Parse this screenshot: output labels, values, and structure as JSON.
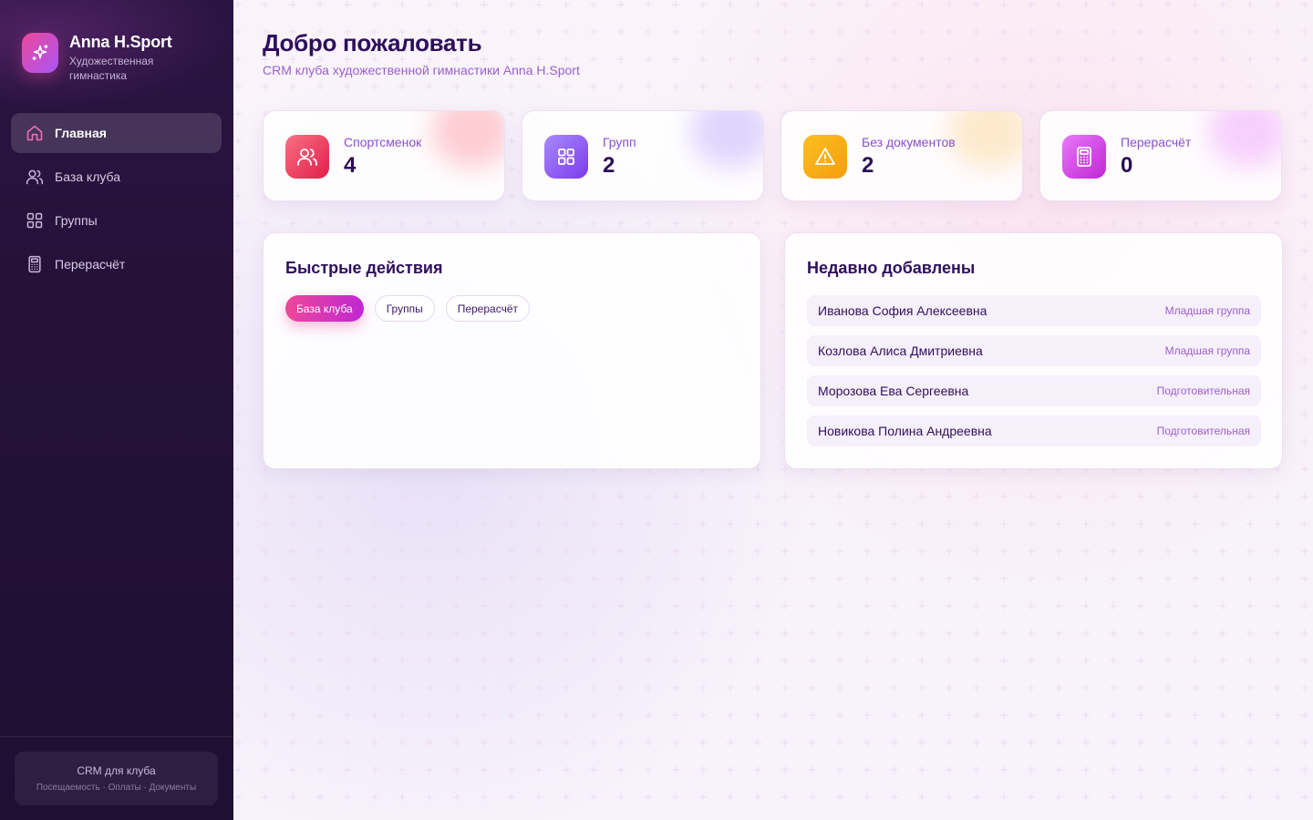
{
  "brand": {
    "title": "Anna H.Sport",
    "subtitle": "Художественная гимнастика",
    "icon": "sparkles-icon"
  },
  "nav": {
    "items": [
      {
        "label": "Главная",
        "icon": "home-icon",
        "active": true
      },
      {
        "label": "База клуба",
        "icon": "users-icon",
        "active": false
      },
      {
        "label": "Группы",
        "icon": "grid-icon",
        "active": false
      },
      {
        "label": "Перерасчёт",
        "icon": "calculator-icon",
        "active": false
      }
    ]
  },
  "sidebar_footer": {
    "title": "CRM для клуба",
    "subtitle": "Посещаемость · Оплаты · Документы"
  },
  "header": {
    "title": "Добро пожаловать",
    "subtitle": "CRM клуба художественной гимнастики Anna H.Sport"
  },
  "stats": [
    {
      "label": "Спортсменок",
      "value": "4",
      "icon": "users-icon",
      "color": "#f43f5e"
    },
    {
      "label": "Групп",
      "value": "2",
      "icon": "grid-icon",
      "color": "#8b5cf6"
    },
    {
      "label": "Без документов",
      "value": "2",
      "icon": "warning-icon",
      "color": "#f59e0b"
    },
    {
      "label": "Перерасчёт",
      "value": "0",
      "icon": "calculator-icon",
      "color": "#d946ef"
    }
  ],
  "quick_actions": {
    "title": "Быстрые действия",
    "buttons": [
      "База клуба",
      "Группы",
      "Перерасчёт"
    ]
  },
  "recent": {
    "title": "Недавно добавлены",
    "items": [
      {
        "name": "Иванова София Алексеевна",
        "group": "Младшая группа"
      },
      {
        "name": "Козлова Алиса Дмитриевна",
        "group": "Младшая группа"
      },
      {
        "name": "Морозова Ева Сергеевна",
        "group": "Подготовительная"
      },
      {
        "name": "Новикова Полина Андреевна",
        "group": "Подготовительная"
      }
    ]
  }
}
